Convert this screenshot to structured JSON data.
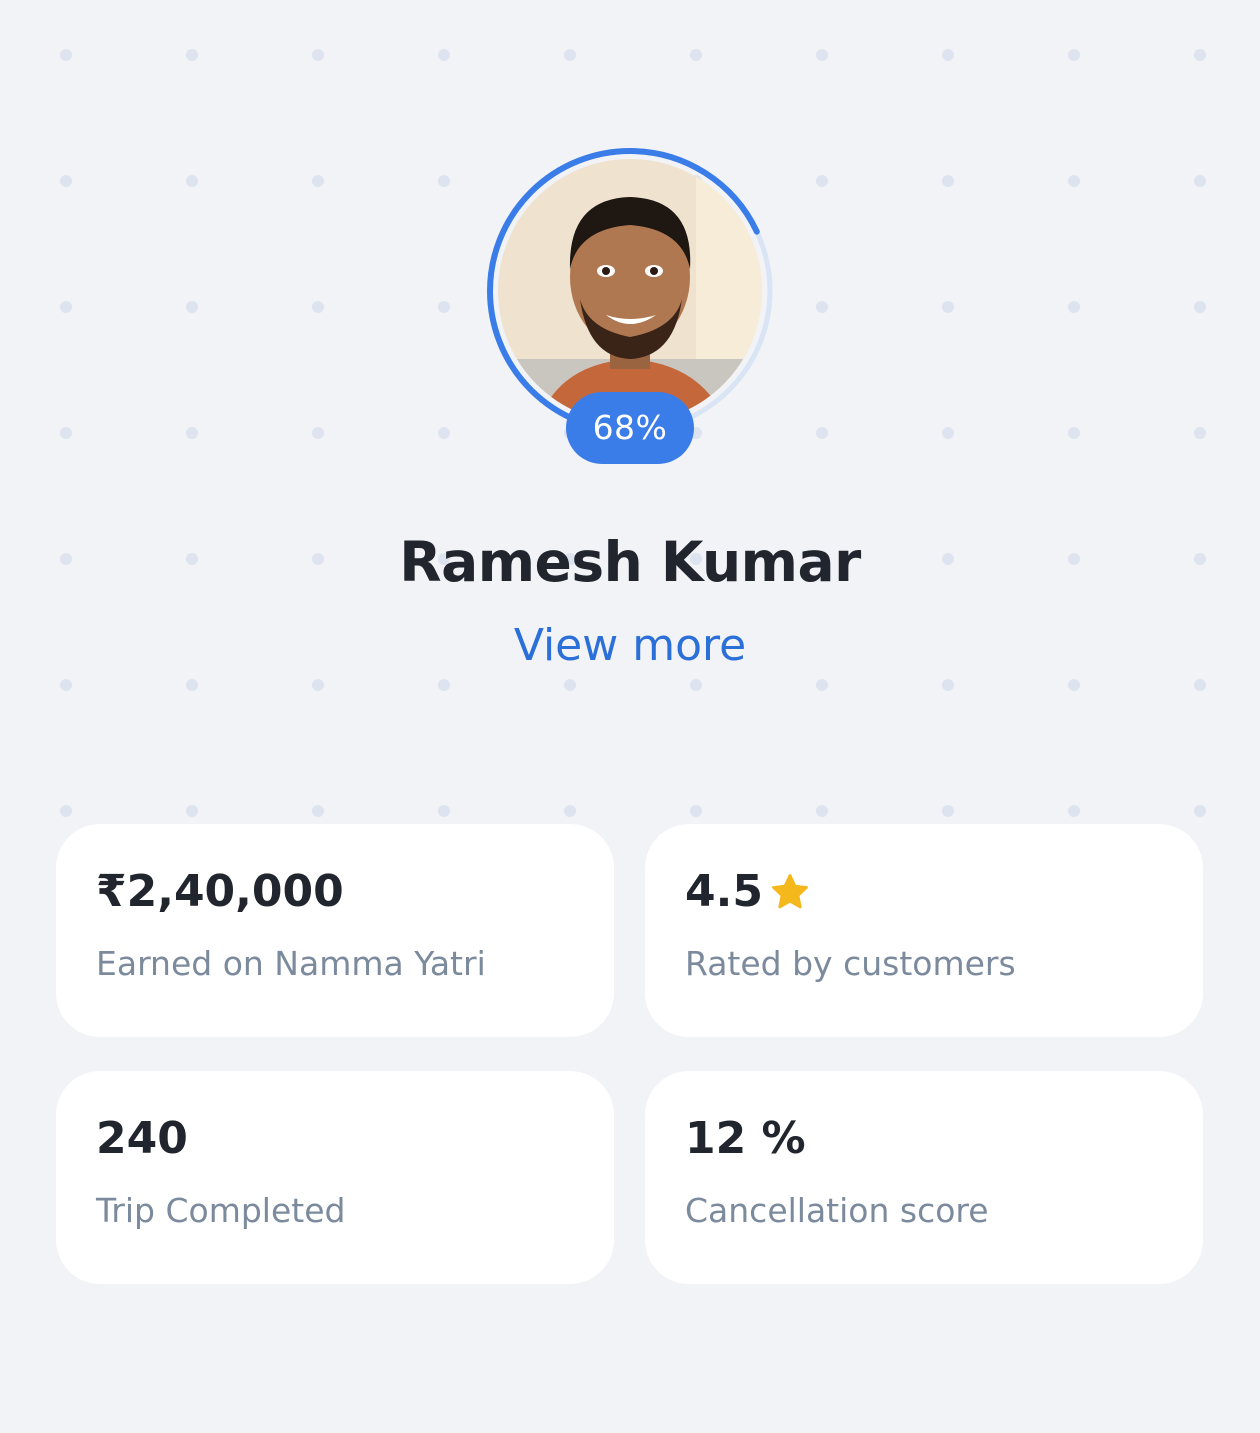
{
  "profile": {
    "completion_label": "68%",
    "completion_fraction": 0.68,
    "name": "Ramesh Kumar",
    "view_more": "View more"
  },
  "stats": [
    {
      "value": "₹2,40,000",
      "label": "Earned on Namma Yatri"
    },
    {
      "value": "4.5",
      "label": "Rated by customers",
      "icon": "star-icon"
    },
    {
      "value": "240",
      "label": "Trip Completed"
    },
    {
      "value": "12 %",
      "label": "Cancellation score"
    }
  ],
  "colors": {
    "accent": "#3b7de8",
    "link": "#2b6fd8",
    "ring_track": "#d9e4f5",
    "star": "#f5b81c",
    "background": "#f1f3f6"
  }
}
